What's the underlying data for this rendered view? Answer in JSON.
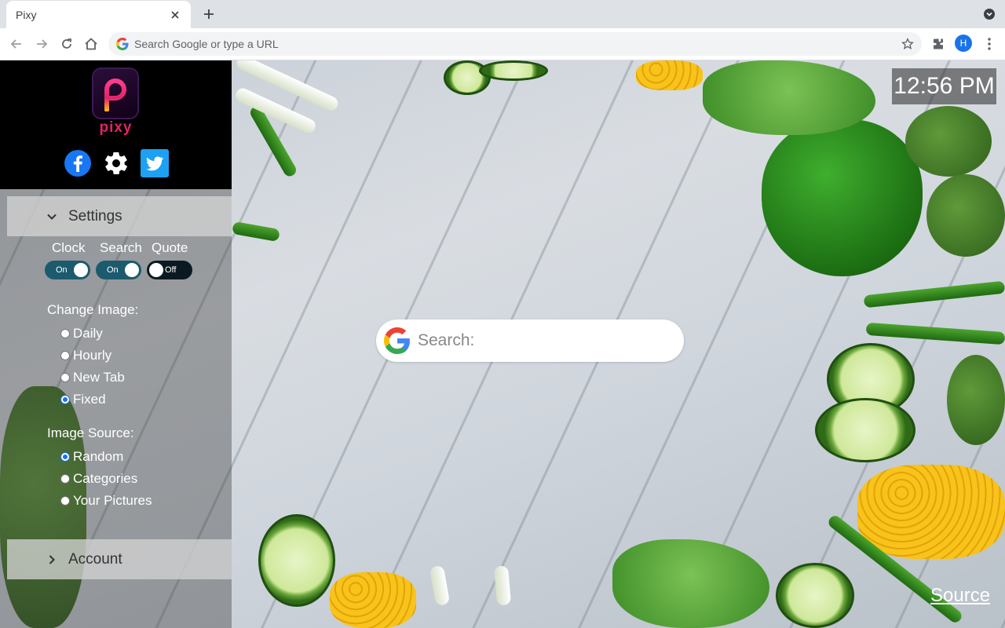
{
  "browser": {
    "tab_title": "Pixy",
    "omnibox_placeholder": "Search Google or type a URL",
    "profile_initial": "H"
  },
  "page": {
    "clock": "12:56 PM",
    "search_placeholder": "Search:",
    "source_link": "Source"
  },
  "panel": {
    "logo_name": "pixy",
    "social": [
      "facebook-icon",
      "gear-icon",
      "twitter-icon"
    ],
    "settings_header": "Settings",
    "toggles": [
      {
        "label": "Clock",
        "state": "On"
      },
      {
        "label": "Search",
        "state": "On"
      },
      {
        "label": "Quote",
        "state": "Off"
      }
    ],
    "change_image": {
      "label": "Change Image:",
      "options": [
        "Daily",
        "Hourly",
        "New Tab",
        "Fixed"
      ],
      "selected": "Fixed"
    },
    "image_source": {
      "label": "Image Source:",
      "options": [
        "Random",
        "Categories",
        "Your Pictures"
      ],
      "selected": "Random"
    },
    "account_header": "Account"
  },
  "colors": {
    "accent": "#1a73e8",
    "logo_pink": "#e0246b",
    "toggle_on": "#1c5a6e"
  }
}
